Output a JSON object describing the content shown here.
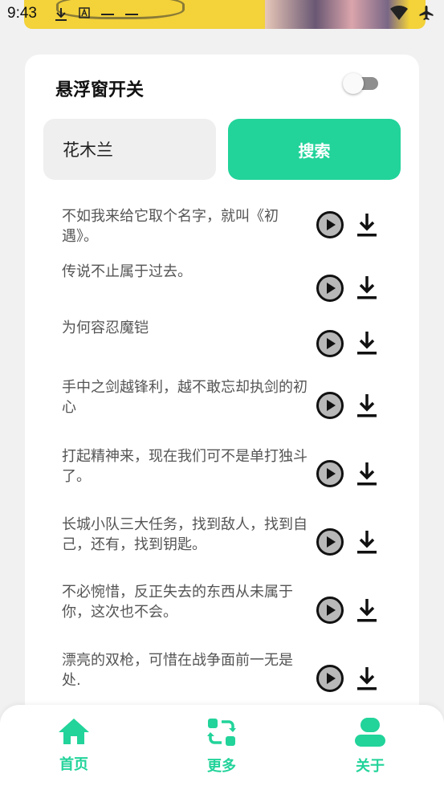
{
  "status_bar": {
    "time": "9:43",
    "left_icons": [
      "download-icon",
      "a-badge-icon"
    ],
    "right_icons": [
      "wifi-icon",
      "airplane-icon"
    ]
  },
  "header": {
    "float_switch_label": "悬浮窗开关",
    "float_switch_on": false
  },
  "search": {
    "value": "花木兰",
    "button_label": "搜索"
  },
  "voice_lines": [
    {
      "text": "不如我来给它取个名字，就叫《初遇》。"
    },
    {
      "text": "传说不止属于过去。"
    },
    {
      "text": "为何容忍魔铠"
    },
    {
      "text": "手中之剑越锋利，越不敢忘却执剑的初心"
    },
    {
      "text": "打起精神来，现在我们可不是单打独斗了。"
    },
    {
      "text": "长城小队三大任务，找到敌人，找到自己，还有，找到钥匙。"
    },
    {
      "text": "不必惋惜，反正失去的东西从未属于你，这次也不会。"
    },
    {
      "text": "漂亮的双枪，可惜在战争面前一无是处."
    }
  ],
  "bottom_nav": {
    "items": [
      {
        "label": "首页",
        "icon": "home-icon"
      },
      {
        "label": "更多",
        "icon": "swap-icon"
      },
      {
        "label": "关于",
        "icon": "person-icon"
      }
    ]
  },
  "colors": {
    "accent": "#22d39a",
    "background": "#f1f1f1",
    "card": "#ffffff",
    "text_secondary": "#555555"
  }
}
